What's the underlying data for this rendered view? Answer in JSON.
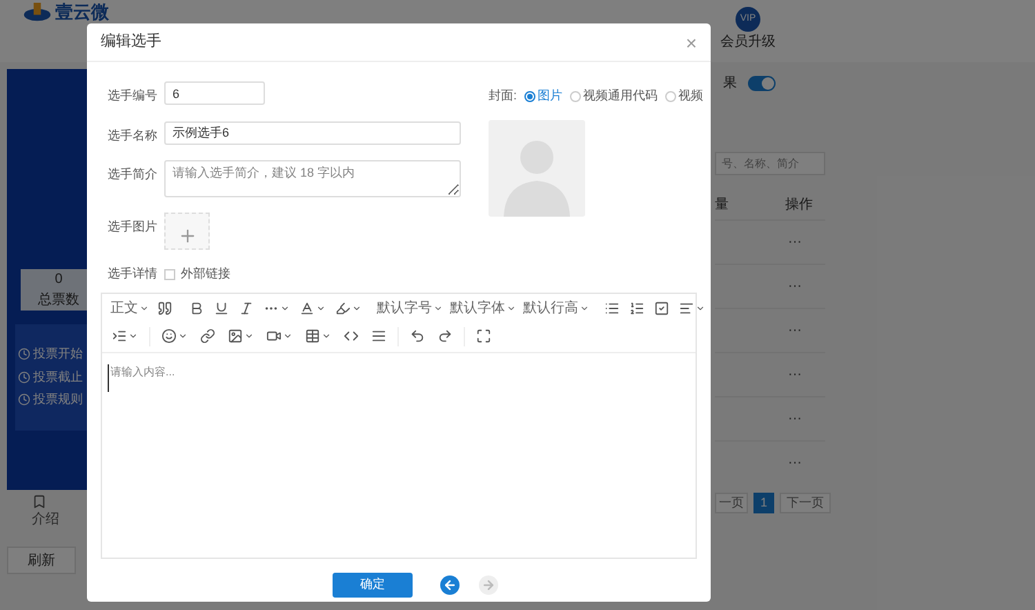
{
  "header": {
    "logo": "壹云微",
    "vip_badge": "VIP",
    "vip_label": "会员升级"
  },
  "banner": {
    "stat_value": "0",
    "stat_label": "总票数",
    "info": [
      "投票开始",
      "投票截止",
      "投票规则"
    ]
  },
  "sidebar_tab": {
    "label": "介绍"
  },
  "refresh_button": "刷新",
  "settings": {
    "toggle_label": "果",
    "toggle_on": true
  },
  "search": {
    "placeholder": "号、名称、简介"
  },
  "table": {
    "columns": [
      "量",
      "操作"
    ],
    "rows": [
      {
        "action": "···"
      },
      {
        "action": "···"
      },
      {
        "action": "···"
      },
      {
        "action": "···"
      },
      {
        "action": "···"
      },
      {
        "action": "···"
      }
    ]
  },
  "pagination": {
    "prev": "一页",
    "pages": [
      {
        "label": "1",
        "selected": true
      }
    ],
    "next": "下一页"
  },
  "dialog": {
    "title": "编辑选手",
    "close": "×",
    "fields": [
      {
        "kind": "input",
        "label": "选手编号",
        "value": "6",
        "wide": false
      },
      {
        "kind": "input",
        "label": "选手名称",
        "value": "示例选手6",
        "wide": true
      },
      {
        "kind": "textarea",
        "label": "选手简介",
        "placeholder": "请输入选手简介，建议 18 字以内"
      },
      {
        "kind": "upload",
        "label": "选手图片"
      },
      {
        "kind": "checkbox",
        "label": "选手详情",
        "option": "外部链接",
        "checked": false
      }
    ],
    "cover": {
      "label": "封面:",
      "options": [
        {
          "label": "图片",
          "selected": true
        },
        {
          "label": "视频通用代码",
          "selected": false
        },
        {
          "label": "视频",
          "selected": false
        }
      ]
    },
    "editor": {
      "dropdowns": [
        "正文",
        "默认字号",
        "默认字体",
        "默认行高"
      ],
      "placeholder": "请输入内容..."
    },
    "confirm_button": "确定"
  }
}
